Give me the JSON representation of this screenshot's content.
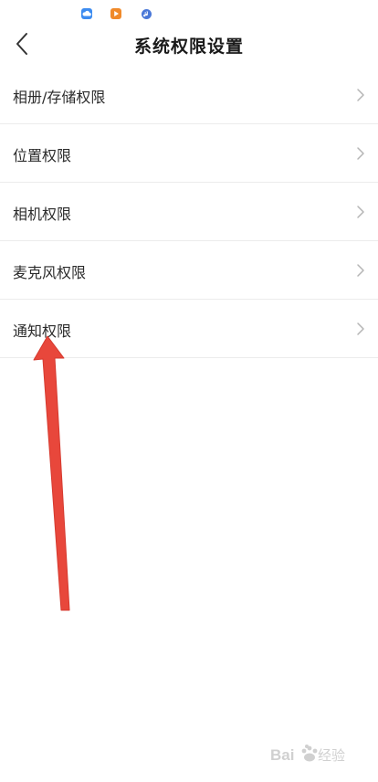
{
  "status_bar": {
    "icons": [
      "cloud-icon",
      "video-play-icon",
      "music-icon"
    ]
  },
  "header": {
    "title": "系统权限设置",
    "back_icon": "chevron-left-icon"
  },
  "settings": {
    "items": [
      {
        "label": "相册/存储权限"
      },
      {
        "label": "位置权限"
      },
      {
        "label": "相机权限"
      },
      {
        "label": "麦克风权限"
      },
      {
        "label": "通知权限"
      }
    ]
  },
  "annotation": {
    "color": "#e8473b",
    "target": "通知权限"
  },
  "watermark": {
    "text": "Baidu 经验"
  }
}
